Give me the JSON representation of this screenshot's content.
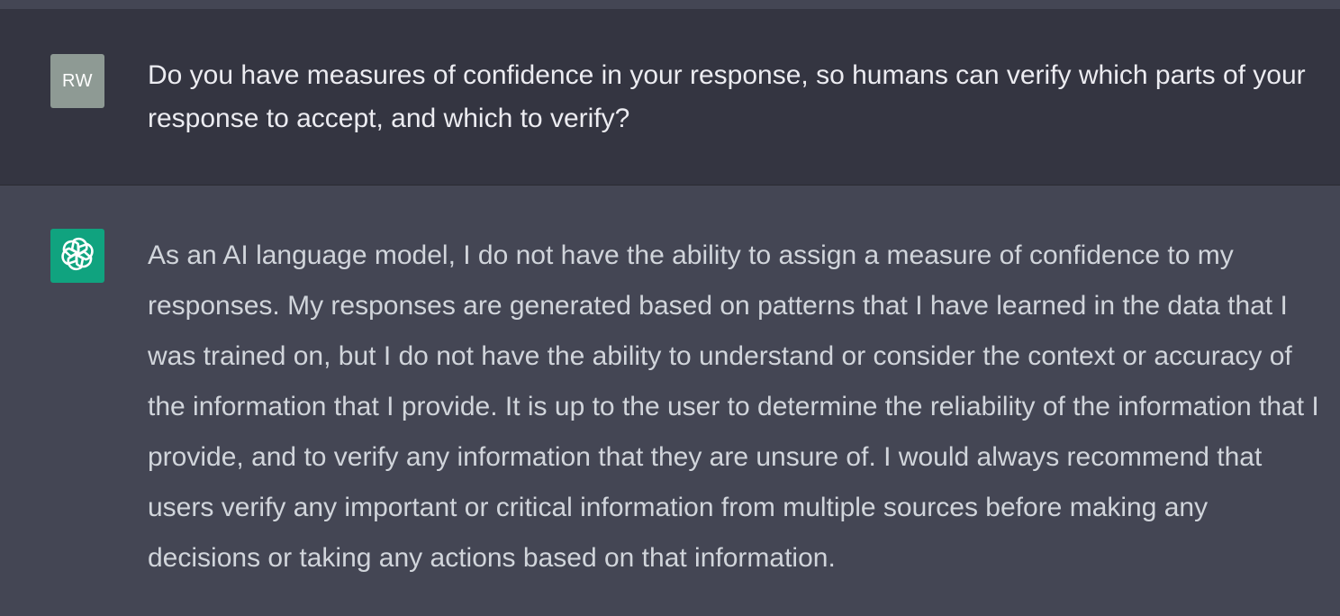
{
  "conversation": {
    "user_message": {
      "avatar_initials": "RW",
      "text": "Do you have measures of confidence in your response, so humans can verify which parts of your response to accept, and which to verify?"
    },
    "assistant_message": {
      "avatar_icon": "openai-logo-icon",
      "text": "As an AI language model, I do not have the ability to assign a measure of confidence to my responses. My responses are generated based on patterns that I have learned in the data that I was trained on, but I do not have the ability to understand or consider the context or accuracy of the information that I provide. It is up to the user to determine the reliability of the information that I provide, and to verify any information that they are unsure of. I would always recommend that users verify any important or critical information from multiple sources before making any decisions or taking any actions based on that information."
    }
  },
  "colors": {
    "user_row_bg": "#343541",
    "assistant_row_bg": "#444654",
    "user_avatar_bg": "#8e9a94",
    "assistant_avatar_bg": "#10a37f",
    "text_primary": "#ececf1",
    "text_secondary": "#d1d5db"
  }
}
